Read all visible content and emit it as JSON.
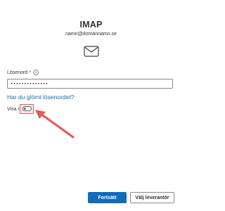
{
  "header": {
    "title": "IMAP",
    "email": "namn@domännamn.se"
  },
  "icons": {
    "mail": "mail-envelope-icon",
    "info": "info-circle-icon"
  },
  "password": {
    "label": "Lösenord",
    "required_marker": "*",
    "value": "••••••••••••••"
  },
  "forgot_link": "Har du glömt lösenordet?",
  "show_more": {
    "label": "Visa mer",
    "toggle_state": "off"
  },
  "actions": {
    "continue_label": "Fortsätt",
    "choose_provider_label": "Välj leverantör"
  },
  "colors": {
    "accent": "#0f6cbd",
    "highlight": "#e35a5a"
  }
}
